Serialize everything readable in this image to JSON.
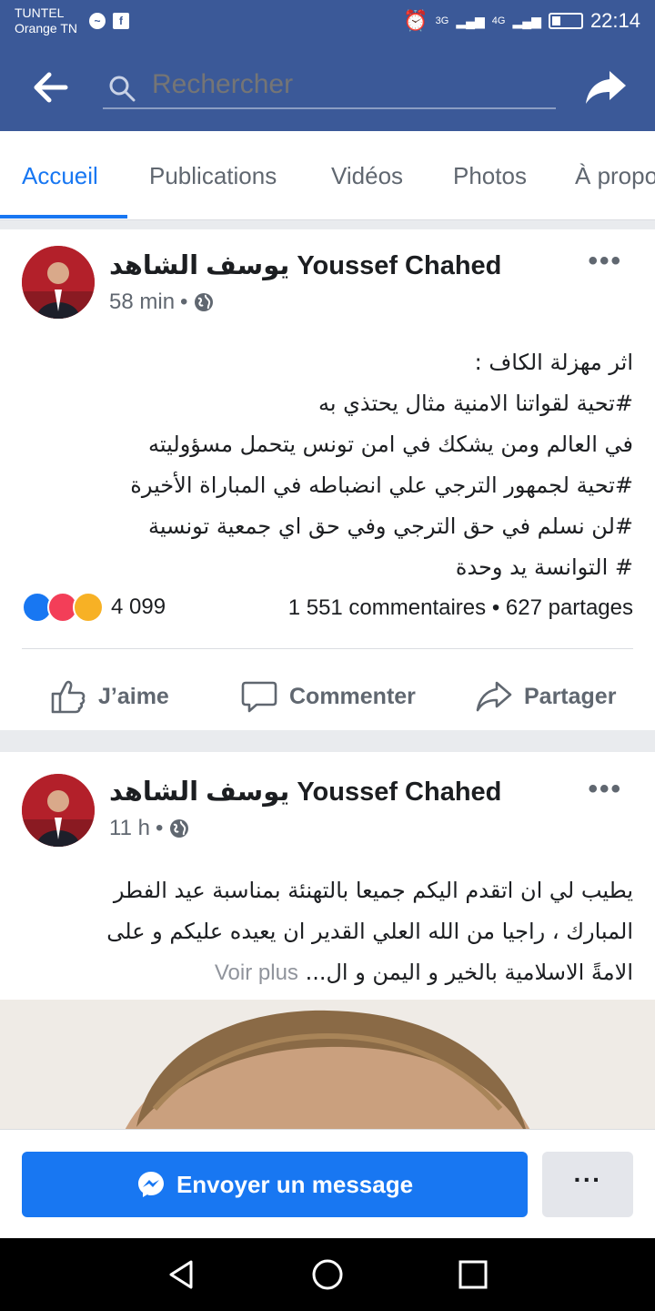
{
  "status_bar": {
    "carrier_line1": "TUNTEL",
    "carrier_line2": "Orange TN",
    "net1": "3G",
    "net2": "4G",
    "time": "22:14"
  },
  "header": {
    "search_placeholder": "Rechercher"
  },
  "tabs": [
    {
      "label": "Accueil",
      "active": true
    },
    {
      "label": "Publications"
    },
    {
      "label": "Vidéos"
    },
    {
      "label": "Photos"
    },
    {
      "label": "À propos"
    }
  ],
  "posts": [
    {
      "author": "يوسف الشاهد Youssef Chahed",
      "time": "58 min",
      "lines": [
        "اثر مهزلة الكاف :",
        "#تحية لقواتنا الامنية مثال يحتذي به",
        "في العالم ومن يشكك في امن تونس يتحمل مسؤوليته",
        "#تحية لجمهور الترجي علي انضباطه في المباراة الأخيرة",
        "#لن نسلم في حق الترجي وفي حق اي جمعية تونسية",
        "# التوانسة يد وحدة"
      ],
      "reaction_count": "4 099",
      "stats": "1 551 commentaires • 627 partages",
      "actions": {
        "like": "J’aime",
        "comment": "Commenter",
        "share": "Partager"
      }
    },
    {
      "author": "يوسف الشاهد Youssef Chahed",
      "time": "11 h",
      "lines": [
        "يطيب لي ان اتقدم اليكم جميعا بالتهنئة بمناسبة عيد الفطر",
        "المبارك ، راجيا من الله العلي القدير ان يعيده عليكم و على",
        "الامةً الاسلامية بالخير و اليمن و ال..."
      ],
      "see_more": "Voir plus"
    }
  ],
  "message_bar": {
    "send_label": "Envoyer un message",
    "more_label": "···"
  },
  "colors": {
    "brand": "#3b5998",
    "accent": "#1877f2"
  }
}
